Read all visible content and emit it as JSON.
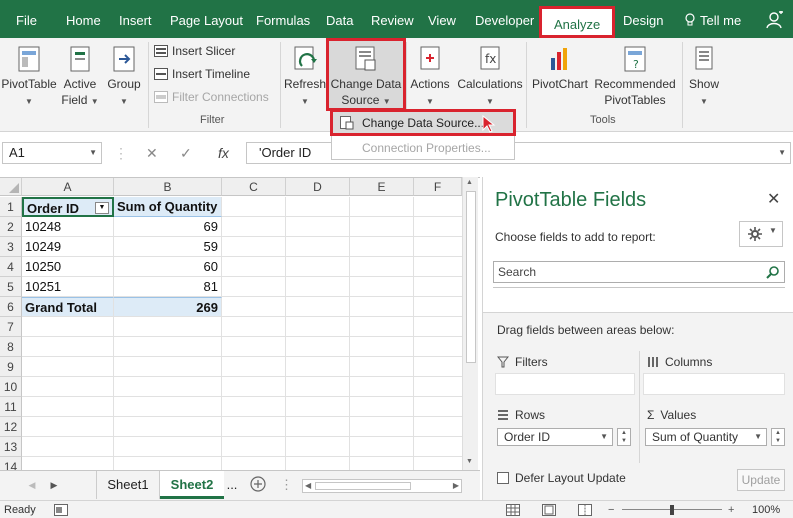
{
  "tabs": [
    "File",
    "Home",
    "Insert",
    "Page Layout",
    "Formulas",
    "Data",
    "Review",
    "View",
    "Developer",
    "Analyze",
    "Design",
    "Tell me"
  ],
  "ribbon": {
    "pivottable": "PivotTable",
    "active_field_1": "Active",
    "active_field_2": "Field",
    "group": "Group",
    "insert_slicer": "Insert Slicer",
    "insert_timeline": "Insert Timeline",
    "filter_connections": "Filter Connections",
    "filter_group": "Filter",
    "refresh": "Refresh",
    "change_ds_1": "Change Data",
    "change_ds_2": "Source",
    "actions": "Actions",
    "calculations": "Calculations",
    "pivotchart": "PivotChart",
    "recommended_1": "Recommended",
    "recommended_2": "PivotTables",
    "tools_group": "Tools",
    "show": "Show"
  },
  "dropdown": {
    "change_data_source": "Change Data Source...",
    "connection_properties": "Connection Properties..."
  },
  "formula_bar": {
    "name_box": "A1",
    "fx": "fx",
    "content": "'Order ID"
  },
  "grid": {
    "columns": [
      "A",
      "B",
      "C",
      "D",
      "E",
      "F"
    ],
    "rows": [
      "1",
      "2",
      "3",
      "4",
      "5",
      "6",
      "7",
      "8",
      "9",
      "10",
      "11",
      "12",
      "13",
      "14"
    ],
    "header": [
      "Order ID",
      "Sum of Quantity"
    ],
    "data": [
      [
        "10248",
        "69"
      ],
      [
        "10249",
        "59"
      ],
      [
        "10250",
        "60"
      ],
      [
        "10251",
        "81"
      ]
    ],
    "total": [
      "Grand Total",
      "269"
    ]
  },
  "sheets": {
    "sheet1": "Sheet1",
    "sheet2": "Sheet2",
    "more": "..."
  },
  "status": {
    "ready": "Ready",
    "zoom": "100%"
  },
  "pivot_pane": {
    "title": "PivotTable Fields",
    "subtitle": "Choose fields to add to report:",
    "search_placeholder": "Search",
    "drag_label": "Drag fields between areas below:",
    "filters": "Filters",
    "columns": "Columns",
    "rows": "Rows",
    "values": "Values",
    "rows_field": "Order ID",
    "values_field": "Sum of Quantity",
    "defer": "Defer Layout Update",
    "update": "Update"
  },
  "colors": {
    "excel_green": "#217346",
    "highlight_red": "#d9232e",
    "pivot_header_blue": "#ddebf7"
  }
}
